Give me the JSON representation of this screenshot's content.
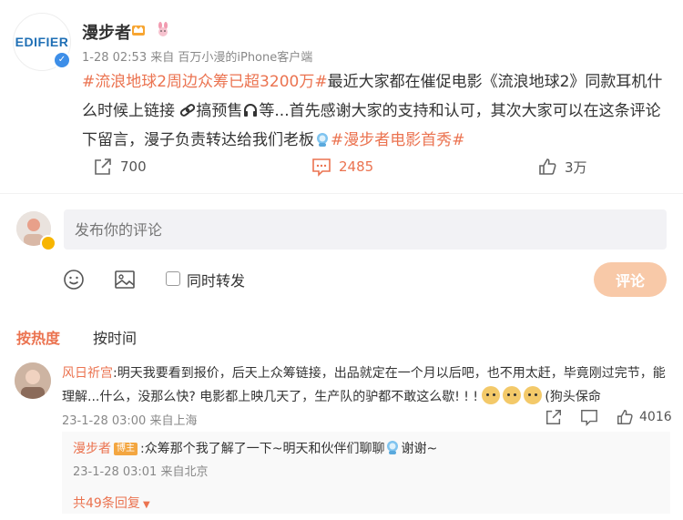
{
  "post": {
    "logo_text": "EDIFIER",
    "username": "漫步者",
    "meta": "1-28 02:53  来自 百万小漫的iPhone客户端",
    "content": {
      "tag1": "#流浪地球2周边众筹已超3200万#",
      "text1": "最近大家都在催促电影《流浪地球2》同款耳机什么时候上链接",
      "text2": "搞预售",
      "text3": "等...首先感谢大家的支持和认可，其次大家可以在这条评论下留言，漫子负责转达给我们老板",
      "tag2": "#漫步者电影首秀#"
    },
    "actions": {
      "repost": "700",
      "comment": "2485",
      "like": "3万"
    }
  },
  "composer": {
    "placeholder": "发布你的评论",
    "forward_label": "同时转发",
    "submit_label": "评论"
  },
  "tabs": {
    "hot": "按热度",
    "time": "按时间"
  },
  "comment": {
    "name": "风日祈宫",
    "text": ":明天我要看到报价，后天上众筹链接，出品就定在一个月以后吧，也不用太赶，毕竟刚过完节，能理解...什么，没那么快? 电影都上映几天了，生产队的驴都不敢这么歇! ! ! ",
    "tail": "(狗头保命",
    "time": "23-1-28 03:00 来自上海",
    "likes": "4016"
  },
  "reply": {
    "name": "漫步者",
    "badge": "博主",
    "text": ":众筹那个我了解了一下~明天和伙伴们聊聊",
    "text_tail": "谢谢~",
    "time": "23-1-28 03:01 来自北京",
    "more": "共49条回复"
  },
  "colors": {
    "accent": "#eb7350",
    "brand_blue": "#1f6fb5",
    "submit_bg": "#f8c9a8"
  }
}
